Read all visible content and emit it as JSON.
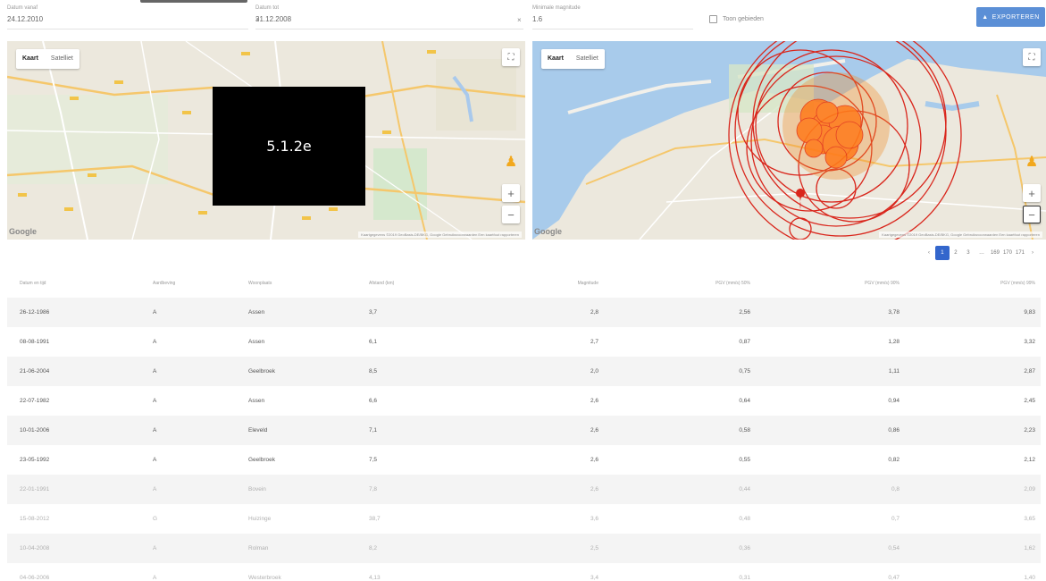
{
  "filters": {
    "start_label": "Datum vanaf",
    "start_value": "24.12.2010",
    "end_label": "Datum tot",
    "end_value": "31.12.2008",
    "magnitude_label": "Minimale magnitude",
    "magnitude_value": "1.6",
    "checkbox_label": "Toon gebieden",
    "export_label": "EXPORTEREN",
    "clear_symbol": "×"
  },
  "map_left": {
    "type_map": "Kaart",
    "type_satellite": "Satelliet",
    "google": "Google",
    "attribution": "Kaartgegevens ©2019 GeoBasis-DE/BKG, Google   Gebruiksvoorwaarden   Een kaartfout rapporteren",
    "version_overlay": "5.1.2e",
    "fullscreen_symbol": "⛶",
    "zoom_in_symbol": "+",
    "zoom_out_symbol": "−",
    "pegman_symbol": "♟"
  },
  "map_right": {
    "type_map": "Kaart",
    "type_satellite": "Satelliet",
    "google": "Google",
    "attribution": "Kaartgegevens ©2019 GeoBasis-DE/BKG, Google   Gebruiksvoorwaarden   Een kaartfout rapporteren",
    "fullscreen_symbol": "⛶",
    "zoom_in_symbol": "+",
    "zoom_out_symbol": "−",
    "pegman_symbol": "♟",
    "colors": {
      "circle": "#d9261c",
      "fill": "#f28c28",
      "water": "#a6c8e8",
      "land": "#ede9dc"
    }
  },
  "pagination": {
    "prev": "‹",
    "pages": [
      "1",
      "2",
      "3"
    ],
    "active": "1",
    "ellipsis": "…",
    "tail_pages": [
      "169",
      "170",
      "171"
    ],
    "next": "›"
  },
  "table": {
    "headers": [
      "Datum en tijd",
      "Aardbeving",
      "Woonplaats",
      "Afstand (km)",
      "Magnitude",
      "PGV (mm/s) 50%",
      "PGV (mm/s) 90%",
      "PGV (mm/s) 99%"
    ],
    "rows": [
      [
        "26-12-1986",
        "A",
        "Assen",
        "3,7",
        "2,8",
        "2,56",
        "3,78",
        "9,83"
      ],
      [
        "08-08-1991",
        "A",
        "Assen",
        "6,1",
        "2,7",
        "0,87",
        "1,28",
        "3,32"
      ],
      [
        "21-06-2004",
        "A",
        "Geelbroek",
        "8,5",
        "2,0",
        "0,75",
        "1,11",
        "2,87"
      ],
      [
        "22-07-1982",
        "A",
        "Assen",
        "6,6",
        "2,6",
        "0,64",
        "0,94",
        "2,45"
      ],
      [
        "10-01-2006",
        "A",
        "Eleveld",
        "7,1",
        "2,6",
        "0,58",
        "0,86",
        "2,23"
      ],
      [
        "23-05-1992",
        "A",
        "Geelbroek",
        "7,5",
        "2,6",
        "0,55",
        "0,82",
        "2,12"
      ],
      [
        "22-01-1991",
        "A",
        "Bovein",
        "7,8",
        "2,6",
        "0,44",
        "0,8",
        "2,09"
      ],
      [
        "15-08-2012",
        "G",
        "Huizinge",
        "38,7",
        "3,6",
        "0,48",
        "0,7",
        "3,65"
      ],
      [
        "10-04-2008",
        "A",
        "Rolman",
        "8,2",
        "2,5",
        "0,36",
        "0,54",
        "1,62"
      ],
      [
        "04-06-2006",
        "A",
        "Westerbroek",
        "4,13",
        "3,4",
        "0,31",
        "0,47",
        "1,40"
      ]
    ]
  }
}
